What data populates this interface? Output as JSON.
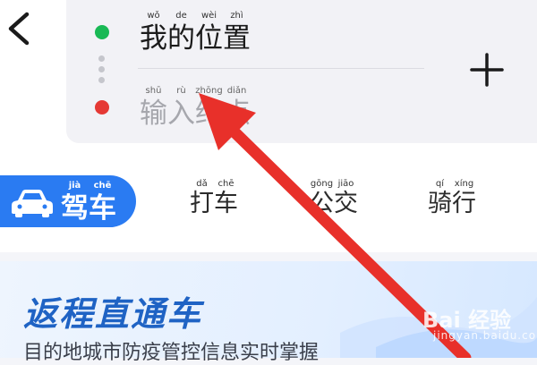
{
  "route": {
    "origin": {
      "chars": [
        {
          "py": "wǒ",
          "hz": "我"
        },
        {
          "py": "de",
          "hz": "的"
        },
        {
          "py": "wèi",
          "hz": "位"
        },
        {
          "py": "zhì",
          "hz": "置"
        }
      ]
    },
    "destination": {
      "chars": [
        {
          "py": "shū",
          "hz": "输"
        },
        {
          "py": "rù",
          "hz": "入"
        },
        {
          "py": "zhōng",
          "hz": "终"
        },
        {
          "py": "diǎn",
          "hz": "点"
        }
      ]
    }
  },
  "modes": [
    {
      "name": "drive",
      "active": true,
      "chars": [
        {
          "py": "jià",
          "hz": "驾"
        },
        {
          "py": "chē",
          "hz": "车"
        }
      ]
    },
    {
      "name": "taxi",
      "active": false,
      "chars": [
        {
          "py": "dǎ",
          "hz": "打"
        },
        {
          "py": "chē",
          "hz": "车"
        }
      ]
    },
    {
      "name": "bus",
      "active": false,
      "chars": [
        {
          "py": "gōng",
          "hz": "公"
        },
        {
          "py": "jiāo",
          "hz": "交"
        }
      ]
    },
    {
      "name": "bike",
      "active": false,
      "chars": [
        {
          "py": "qí",
          "hz": "骑"
        },
        {
          "py": "xíng",
          "hz": "行"
        }
      ]
    }
  ],
  "banner": {
    "title": "返程直通车",
    "subtitle": "目的地城市防疫管控信息实时掌握"
  },
  "watermark": {
    "text": "Bai 经验",
    "sub": "jingyan.baidu.com"
  },
  "colors": {
    "accent": "#2a7bf2",
    "start_dot": "#19b955",
    "end_dot": "#e53935",
    "annotation_arrow": "#e8302a"
  },
  "icons": {
    "back": "chevron-left-icon",
    "add": "plus-icon",
    "drive": "car-icon"
  }
}
